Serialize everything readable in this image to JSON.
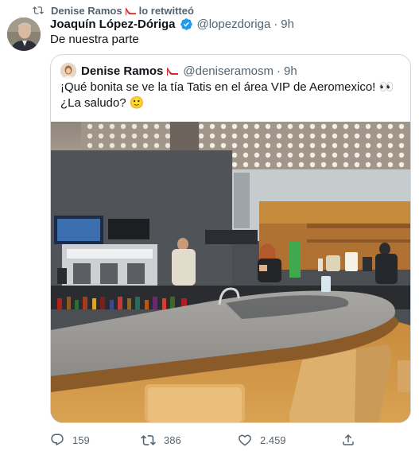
{
  "retweet": {
    "icon": "retweet-icon",
    "user": "Denise Ramos",
    "user_emoji": "high-heel-icon",
    "suffix": "lo retwitteó"
  },
  "tweet": {
    "author_name": "Joaquín López-Dóriga",
    "verified": true,
    "handle": "@lopezdoriga",
    "separator": "·",
    "time": "9h",
    "text": "De nuestra parte"
  },
  "quoted": {
    "author_name": "Denise Ramos",
    "author_emoji": "high-heel-icon",
    "handle": "@deniseramosm",
    "separator": "·",
    "time": "9h",
    "text_part1": "¡Qué bonita se ve la tía Tatis en el área VIP de Aeromexico!",
    "eyes_emoji": "👀",
    "text_part2": "¿La saludo?",
    "smile_emoji": "🙂",
    "photo_alt": "Airport VIP lounge bar"
  },
  "actions": {
    "reply_count": "159",
    "retweet_count": "386",
    "like_count": "2.459"
  },
  "colors": {
    "text_primary": "#0f1419",
    "text_secondary": "#536471",
    "verified_blue": "#1d9bf0",
    "border": "#cfd9de"
  }
}
